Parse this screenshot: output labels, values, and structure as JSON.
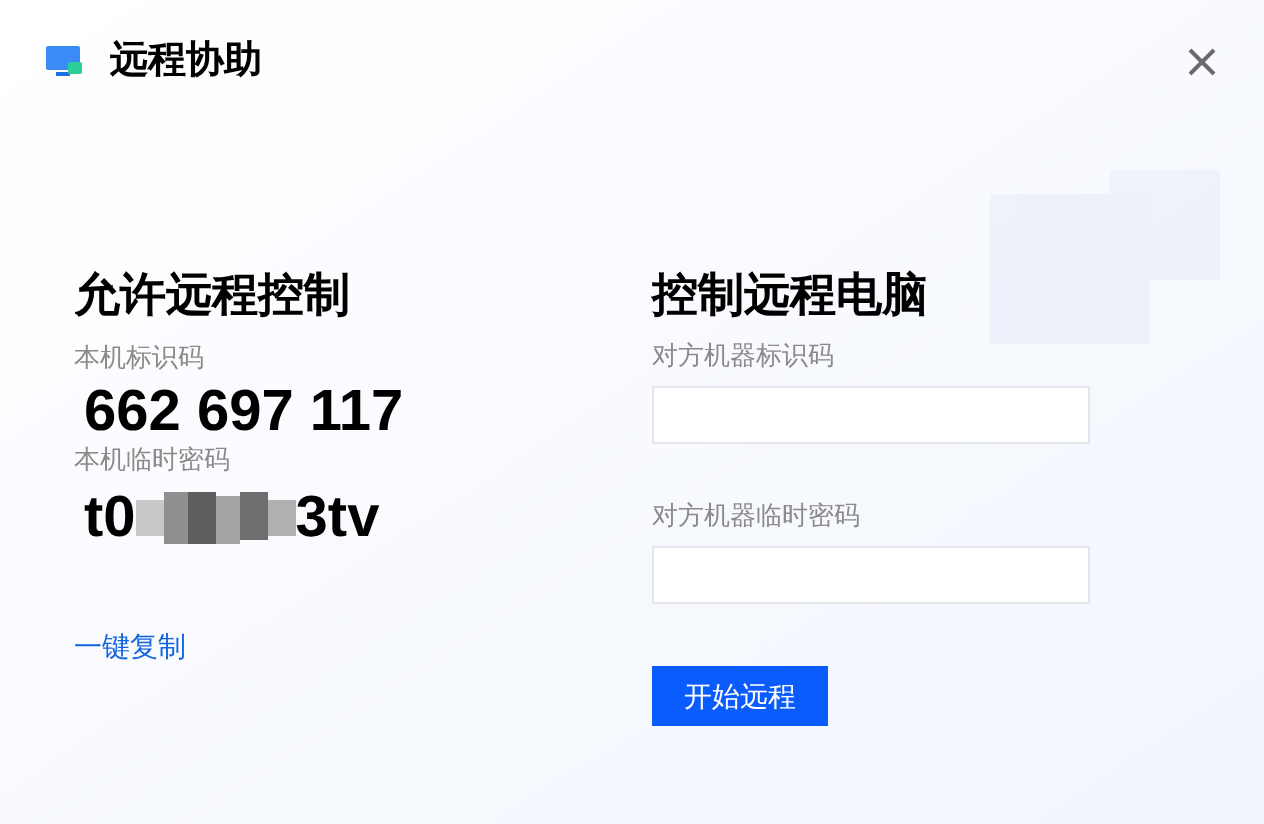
{
  "window": {
    "title": "远程协助"
  },
  "allow_control": {
    "heading": "允许远程控制",
    "id_label": "本机标识码",
    "id_value": "662 697 117",
    "password_label": "本机临时密码",
    "password": {
      "start": "t0",
      "end": "3tv",
      "masked": true
    },
    "copy_link": "一键复制"
  },
  "remote_control": {
    "heading": "控制远程电脑",
    "fields": [
      {
        "label": "对方机器标识码"
      },
      {
        "label": "对方机器临时密码"
      }
    ],
    "button": "开始远程"
  }
}
